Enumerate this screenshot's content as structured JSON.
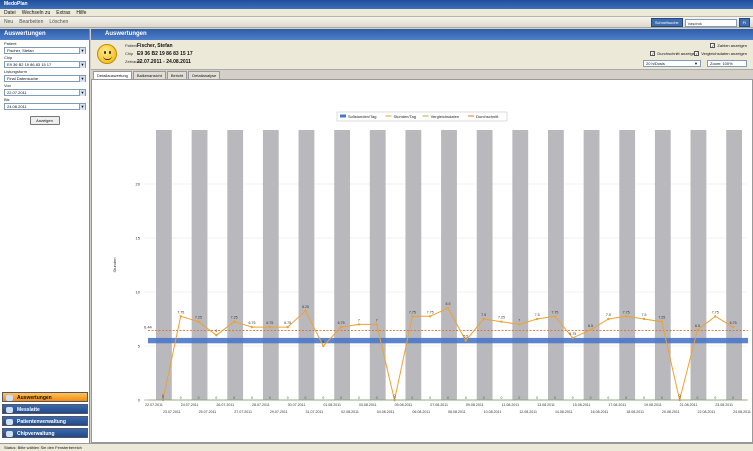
{
  "window": {
    "title": "MedoPlan"
  },
  "menu": [
    "Datei",
    "Wechseln zu",
    "Extras",
    "Hilfe"
  ],
  "toolbar": [
    "Neu",
    "Bearbeiten",
    "Löschen"
  ],
  "search": {
    "button": "Schnellsuche",
    "value": "Vasdrok",
    "label": "Fl"
  },
  "left": {
    "header": "Auswertungen",
    "fields": [
      {
        "label": "Patient",
        "value": "Fischer, Stefan"
      },
      {
        "label": "Chip",
        "value": "E9 36 B2 19 86 83 15 17"
      },
      {
        "label": "Listungsform",
        "value": "Final Datensuche"
      },
      {
        "label": "Von",
        "value": "22.07.2011"
      },
      {
        "label": "Bis",
        "value": "24.08.2011"
      }
    ],
    "button": "Anzeigen",
    "nav": [
      "Auswertungen",
      "Messlatte",
      "Patientenverwaltung",
      "Chipverwaltung"
    ]
  },
  "main": {
    "header": "Auswertungen",
    "info": {
      "patient_label": "Patient",
      "patient": "Fischer, Stefan",
      "chip_label": "Chip",
      "chip": "E9 36 B2 19 86 83 15 17",
      "range_label": "Zeitraum",
      "range": "22.07.2011 - 24.08.2011"
    },
    "options": {
      "show_numbers": "Zahlen anzeigen",
      "show_avg": "Durchschnitt anzeigen",
      "show_comparison": "Vergleichsdaten anzeigen",
      "mode": "20 h/Dosis",
      "zoom": "Zoom: 100%"
    },
    "tabs": [
      "Detailauswertung",
      "Balkenansicht",
      "Bericht",
      "Detailanalyse"
    ]
  },
  "status": "Status: Bitte wählen Sie den Fensterbereich",
  "chart_data": {
    "type": "bar",
    "ylabel": "Stunden",
    "ylim": [
      0,
      25
    ],
    "yticks": [
      0,
      5,
      10,
      15,
      20
    ],
    "legend": [
      "Sollstunden/Tag",
      "Stunden/Tag",
      "Vergleichsdaten",
      "Durchschnitt"
    ],
    "categories": [
      "22.07.2011",
      "23.07.2011",
      "24.07.2011",
      "25.07.2011",
      "26.07.2011",
      "27.07.2011",
      "28.07.2011",
      "29.07.2011",
      "30.07.2011",
      "31.07.2011",
      "01.08.2011",
      "02.08.2011",
      "03.08.2011",
      "04.08.2011",
      "05.08.2011",
      "06.08.2011",
      "07.08.2011",
      "08.08.2011",
      "09.08.2011",
      "10.08.2011",
      "11.08.2011",
      "12.08.2011",
      "13.08.2011",
      "14.08.2011",
      "15.08.2011",
      "16.08.2011",
      "17.08.2011",
      "18.08.2011",
      "19.08.2011",
      "20.08.2011",
      "21.08.2011",
      "22.08.2011",
      "23.08.2011",
      "24.08.2011"
    ],
    "target": {
      "low": 5.25,
      "high": 5.75
    },
    "hours": [
      0,
      7.75,
      7.25,
      6,
      7.25,
      6.75,
      6.75,
      6.75,
      8.25,
      5,
      6.75,
      7,
      7,
      0,
      7.75,
      7.75,
      8.5,
      5.5,
      7.5,
      7.25,
      7,
      7.5,
      7.75,
      5.75,
      6.5,
      7.5,
      7.75,
      7.5,
      7.25,
      0,
      6.5,
      7.75,
      6.75
    ],
    "labels": [
      "0",
      "7.75",
      "7.25",
      "6",
      "7.25",
      "6.75",
      "6.75",
      "6.75",
      "8.25",
      "5",
      "6.75",
      "7",
      "7",
      "0",
      "7.75",
      "7.75",
      "8.5",
      "5.5",
      "7.5",
      "7.25",
      "7",
      "7.5",
      "7.75",
      "5.75",
      "6.5",
      "7.5",
      "7.75",
      "7.5",
      "7.25",
      "0",
      "6.5",
      "7.75",
      "6.75"
    ],
    "average": 6.44,
    "avg_label": "6.44",
    "comparison": 0
  }
}
